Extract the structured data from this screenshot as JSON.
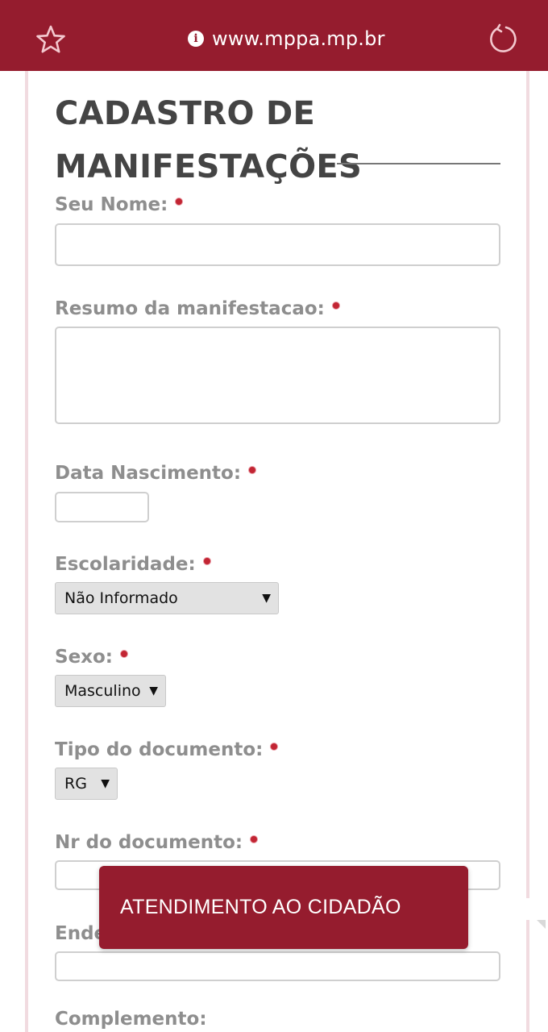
{
  "browser": {
    "url": "www.mppa.mp.br"
  },
  "form": {
    "title_line1": "CADASTRO DE",
    "title_line2": "MANIFESTAÇÕES",
    "labels": {
      "nome": "Seu Nome:",
      "resumo": "Resumo da manifestacao:",
      "nascimento": "Data Nascimento:",
      "escolaridade": "Escolaridade:",
      "sexo": "Sexo:",
      "tipo_documento": "Tipo do documento:",
      "nr_documento": "Nr do documento:",
      "endereco_partial": "Ende",
      "complemento": "Complemento:"
    },
    "selects": {
      "escolaridade": "Não Informado",
      "sexo": "Masculino",
      "tipo_documento": "RG"
    }
  },
  "fab": {
    "label": "ATENDIMENTO AO CIDADÃO"
  },
  "colors": {
    "brand": "#951c2e",
    "required_dot": "#c22533",
    "label_gray": "#8e8e8e",
    "title_gray": "#444444"
  }
}
